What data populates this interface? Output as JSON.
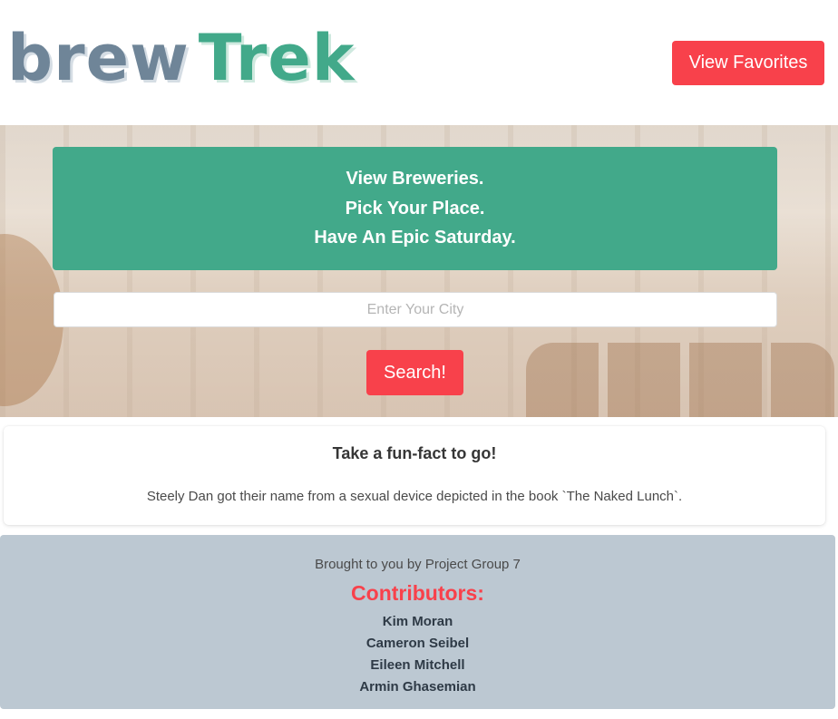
{
  "header": {
    "logo": {
      "part1": "brew",
      "part2": "Trek"
    },
    "favorites_button": "View Favorites"
  },
  "hero": {
    "banner_lines": [
      "View Breweries.",
      "Pick Your Place.",
      "Have An Epic Saturday."
    ],
    "city_input": {
      "value": "",
      "placeholder": "Enter Your City"
    },
    "search_button": "Search!"
  },
  "fact_card": {
    "title": "Take a fun-fact to go!",
    "text": "Steely Dan got their name from a sexual device depicted in the book `The Naked Lunch`."
  },
  "footer": {
    "brought_by": "Brought to you by Project Group 7",
    "contributors_title": "Contributors:",
    "contributors": [
      "Kim Moran",
      "Cameron Seibel",
      "Eileen Mitchell",
      "Armin Ghasemian"
    ]
  },
  "colors": {
    "accent_red": "#f8414b",
    "brand_green": "#42a98a",
    "logo_slate": "#6f8598",
    "footer_bg": "#bcc8d2"
  }
}
